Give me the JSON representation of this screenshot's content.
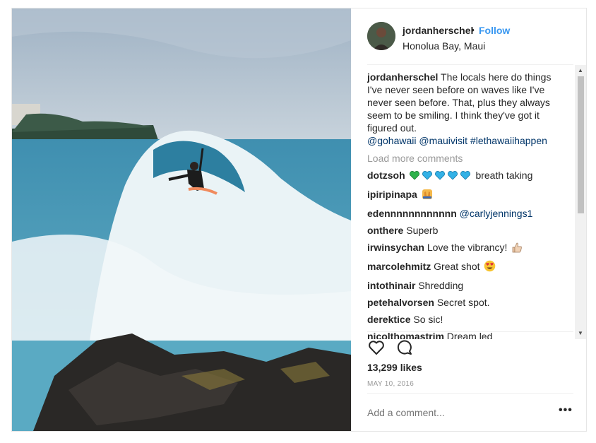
{
  "post": {
    "username": "jordanherschel",
    "separator": "•",
    "follow_label": "Follow",
    "location": "Honolua Bay, Maui",
    "caption_user": "jordanherschel",
    "caption_text": "The locals here do things I've never seen before on waves like I've never seen before. That, plus they always seem to be smiling. I think they've got it figured out.",
    "caption_tags": "@gohawaii @mauivisit #lethawaiihappen",
    "load_more": "Load more comments",
    "comments": [
      {
        "user": "dotzsoh",
        "text": "breath taking"
      },
      {
        "user": "ipiripinapa",
        "text": ""
      },
      {
        "user": "edennnnnnnnnnnn",
        "text": "@carlyjennings1"
      },
      {
        "user": "onthere",
        "text": "Superb"
      },
      {
        "user": "irwinsychan",
        "text": "Love the vibrancy!"
      },
      {
        "user": "marcolehmitz",
        "text": "Great shot"
      },
      {
        "user": "intothinair",
        "text": "Shredding"
      },
      {
        "user": "petehalvorsen",
        "text": "Secret spot."
      },
      {
        "user": "derektice",
        "text": "So sic!"
      },
      {
        "user": "nicolthomastrim",
        "text": "Dream led"
      }
    ],
    "likes": "13,299 likes",
    "date": "MAY 10, 2016",
    "add_comment_placeholder": "Add a comment...",
    "more_options": "•••"
  },
  "colors": {
    "follow": "#3897f0",
    "tag": "#003569",
    "heart_green": "#2fb24c",
    "heart_blue": "#33b1e6"
  }
}
